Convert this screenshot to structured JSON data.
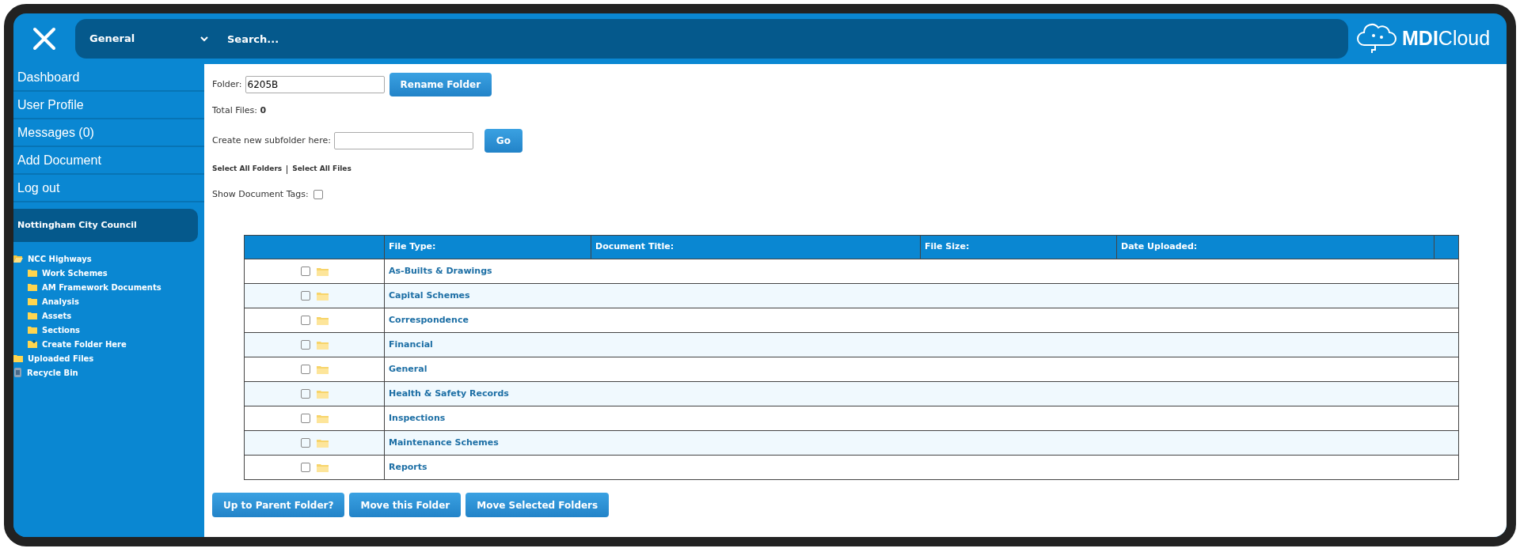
{
  "header": {
    "scope": "General",
    "search_placeholder": "Search...",
    "logo_bold": "MDI",
    "logo_light": "Cloud"
  },
  "sidebar": {
    "nav": [
      "Dashboard",
      "User Profile",
      "Messages (0)",
      "Add Document",
      "Log out"
    ],
    "organisation": "Nottingham City Council",
    "tree": [
      {
        "label": "NCC Highways",
        "kind": "folder",
        "expanded": true,
        "children": [
          {
            "label": "Work Schemes",
            "kind": "folder"
          },
          {
            "label": "AM Framework Documents",
            "kind": "folder"
          },
          {
            "label": "Analysis",
            "kind": "folder"
          },
          {
            "label": "Assets",
            "kind": "folder"
          },
          {
            "label": "Sections",
            "kind": "folder"
          },
          {
            "label": "Create Folder Here",
            "kind": "new-folder"
          }
        ]
      },
      {
        "label": "Uploaded Files",
        "kind": "folder"
      },
      {
        "label": "Recycle Bin",
        "kind": "bin"
      }
    ]
  },
  "folder": {
    "label": "Folder:",
    "value": "6205B",
    "rename_button": "Rename Folder",
    "total_label": "Total Files:",
    "total_value": "0",
    "subfolder_label": "Create new subfolder here:",
    "go_button": "Go",
    "select_links": [
      "Select All Folders",
      "Select All Files"
    ],
    "tags_label": "Show Document Tags:",
    "tags_checked": false
  },
  "table": {
    "columns": [
      "File Type:",
      "Document Title:",
      "File Size:",
      "Date Uploaded:"
    ],
    "rows": [
      {
        "name": "As-Builts & Drawings",
        "checked": false
      },
      {
        "name": "Capital Schemes",
        "checked": false
      },
      {
        "name": "Correspondence",
        "checked": false
      },
      {
        "name": "Financial",
        "checked": false
      },
      {
        "name": "General",
        "checked": false
      },
      {
        "name": "Health & Safety Records",
        "checked": false
      },
      {
        "name": "Inspections",
        "checked": false
      },
      {
        "name": "Maintenance Schemes",
        "checked": false
      },
      {
        "name": "Reports",
        "checked": false
      }
    ]
  },
  "buttons": [
    "Up to Parent Folder?",
    "Move this Folder",
    "Move Selected Folders"
  ]
}
